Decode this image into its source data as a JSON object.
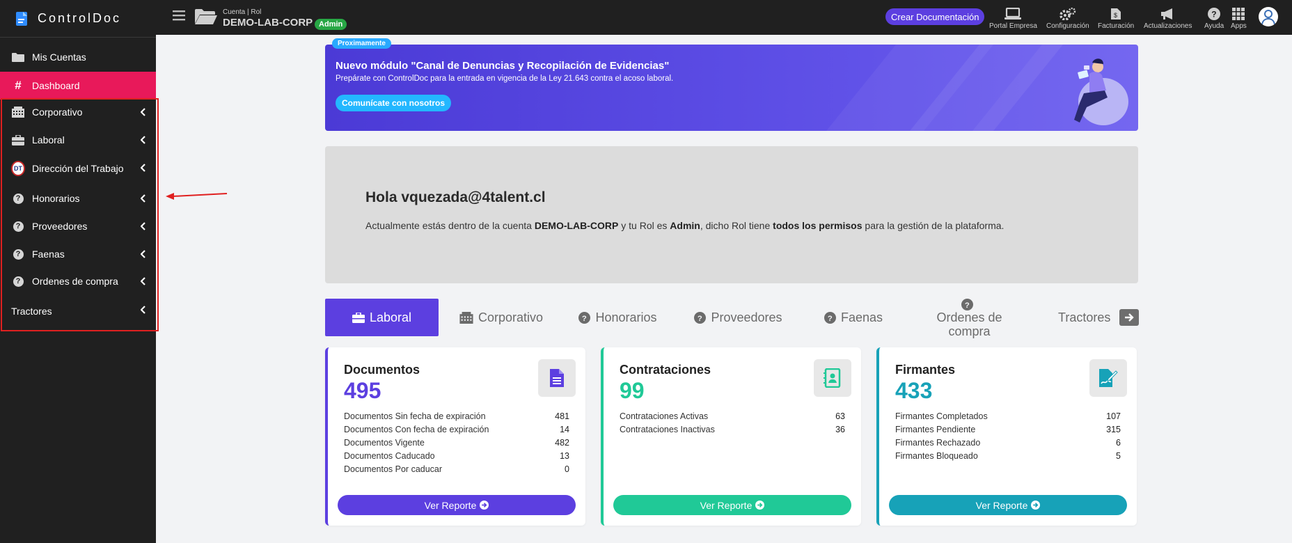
{
  "brand": {
    "name": "ControlDoc"
  },
  "sidebar": {
    "items": [
      {
        "label": "Mis Cuentas",
        "icon": "folder-icon"
      },
      {
        "label": "Dashboard",
        "icon": "hashtag-icon",
        "active": true
      },
      {
        "label": "Corporativo",
        "icon": "building-icon"
      },
      {
        "label": "Laboral",
        "icon": "briefcase-icon"
      },
      {
        "label": "Dirección del Trabajo",
        "icon": "dt-logo-icon",
        "badge": "DT"
      },
      {
        "label": "Honorarios",
        "icon": "question-circle-icon"
      },
      {
        "label": "Proveedores",
        "icon": "question-circle-icon"
      },
      {
        "label": "Faenas",
        "icon": "question-circle-icon"
      },
      {
        "label": "Ordenes de compra",
        "icon": "question-circle-icon"
      },
      {
        "label": "Tractores",
        "icon": ""
      }
    ]
  },
  "topbar": {
    "account_caption": "Cuenta | Rol",
    "account_name": "DEMO-LAB-CORP",
    "role_badge": "Admin",
    "crear_button": "Crear Documentación",
    "items": [
      {
        "label": "Portal Empresa",
        "icon": "laptop-icon"
      },
      {
        "label": "Configuración",
        "icon": "gears-icon"
      },
      {
        "label": "Facturación",
        "icon": "invoice-icon"
      },
      {
        "label": "Actualizaciones",
        "icon": "megaphone-icon"
      },
      {
        "label": "Ayuda",
        "icon": "help-icon"
      },
      {
        "label": "Apps",
        "icon": "grid-icon"
      }
    ]
  },
  "banner": {
    "tag": "Proximamente",
    "title": "Nuevo módulo \"Canal de Denuncias y Recopilación de Evidencias\"",
    "subtitle": "Prepárate con ControlDoc para la entrada en vigencia de la Ley 21.643 contra el acoso laboral.",
    "button": "Comunícate con nosotros"
  },
  "welcome": {
    "greeting": "Hola vquezada@4talent.cl",
    "t1": "Actualmente estás dentro de la cuenta ",
    "account": "DEMO-LAB-CORP",
    "t2": " y tu Rol es ",
    "role": "Admin",
    "t3": ", dicho Rol tiene ",
    "perms": "todos los permisos",
    "t4": " para la gestión de la plataforma."
  },
  "tabs": [
    {
      "label": "Laboral",
      "icon": "briefcase-icon",
      "active": true
    },
    {
      "label": "Corporativo",
      "icon": "building-icon"
    },
    {
      "label": "Honorarios",
      "icon": "question-circle-icon"
    },
    {
      "label": "Proveedores",
      "icon": "question-circle-icon"
    },
    {
      "label": "Faenas",
      "icon": "question-circle-icon"
    },
    {
      "label": "Ordenes de compra",
      "icon": "question-circle-icon"
    },
    {
      "label": "Tractores",
      "icon": ""
    }
  ],
  "cards": [
    {
      "title": "Documentos",
      "total": "495",
      "color": "#5c3fe0",
      "icon": "document-icon",
      "rows": [
        {
          "label": "Documentos Sin fecha de expiración",
          "value": "481"
        },
        {
          "label": "Documentos Con fecha de expiración",
          "value": "14"
        },
        {
          "label": "Documentos Vigente",
          "value": "482"
        },
        {
          "label": "Documentos Caducado",
          "value": "13"
        },
        {
          "label": "Documentos Por caducar",
          "value": "0"
        }
      ],
      "button": "Ver Reporte"
    },
    {
      "title": "Contrataciones",
      "total": "99",
      "color": "#20c997",
      "icon": "contacts-book-icon",
      "rows": [
        {
          "label": "Contrataciones Activas",
          "value": "63"
        },
        {
          "label": "Contrataciones Inactivas",
          "value": "36"
        }
      ],
      "button": "Ver Reporte"
    },
    {
      "title": "Firmantes",
      "total": "433",
      "color": "#17a2b8",
      "icon": "signature-icon",
      "rows": [
        {
          "label": "Firmantes Completados",
          "value": "107"
        },
        {
          "label": "Firmantes Pendiente",
          "value": "315"
        },
        {
          "label": "Firmantes Rechazado",
          "value": "6"
        },
        {
          "label": "Firmantes Bloqueado",
          "value": "5"
        }
      ],
      "button": "Ver Reporte"
    }
  ]
}
